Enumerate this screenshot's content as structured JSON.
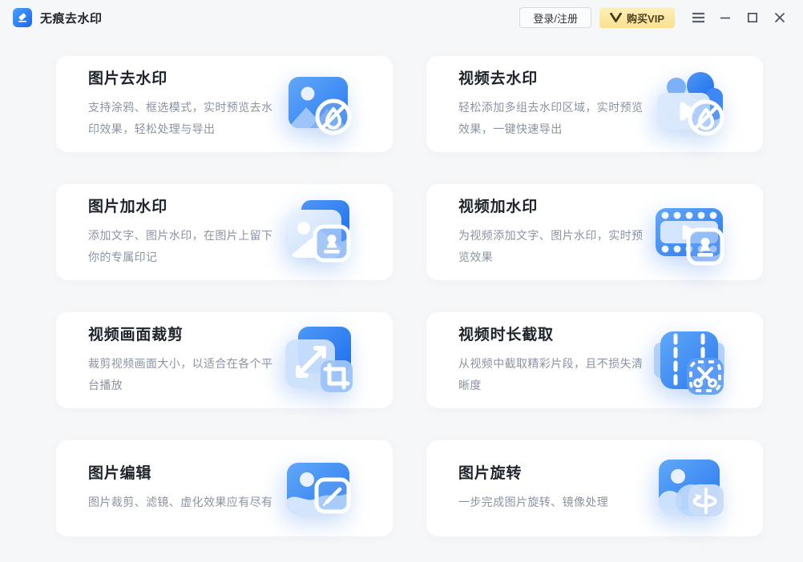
{
  "header": {
    "app_title": "无痕去水印",
    "app_icon": "eraser-icon",
    "login_button": "登录/注册",
    "vip_button": "购买VIP",
    "vip_icon": "vip-v-icon",
    "window_icons": [
      "menu-icon",
      "minimize-icon",
      "maximize-icon",
      "close-icon"
    ]
  },
  "colors": {
    "accent_blue": "#2a79f0",
    "page_background": "#f6f7f8",
    "card_background": "#ffffff",
    "title_text": "#20242c",
    "description_text": "#8b93a3",
    "vip_background": "#f9e08f",
    "vip_text": "#4c4120"
  },
  "cards": [
    {
      "title": "图片去水印",
      "desc": "支持涂鸦、框选模式，实时预览去水印效果，轻松处理与导出",
      "icon": "image-remove-watermark-icon"
    },
    {
      "title": "视频去水印",
      "desc": "轻松添加多组去水印区域，实时预览效果，一键快速导出",
      "icon": "video-remove-watermark-icon"
    },
    {
      "title": "图片加水印",
      "desc": "添加文字、图片水印，在图片上留下你的专属印记",
      "icon": "image-add-watermark-icon"
    },
    {
      "title": "视频加水印",
      "desc": "为视频添加文字、图片水印，实时预览效果",
      "icon": "video-add-watermark-icon"
    },
    {
      "title": "视频画面裁剪",
      "desc": "裁剪视频画面大小，以适合在各个平台播放",
      "icon": "video-crop-icon"
    },
    {
      "title": "视频时长截取",
      "desc": "从视频中截取精彩片段，且不损失清晰度",
      "icon": "video-trim-icon"
    },
    {
      "title": "图片编辑",
      "desc": "图片裁剪、滤镜、虚化效果应有尽有",
      "icon": "image-edit-icon"
    },
    {
      "title": "图片旋转",
      "desc": "一步完成图片旋转、镜像处理",
      "icon": "image-rotate-icon"
    }
  ]
}
